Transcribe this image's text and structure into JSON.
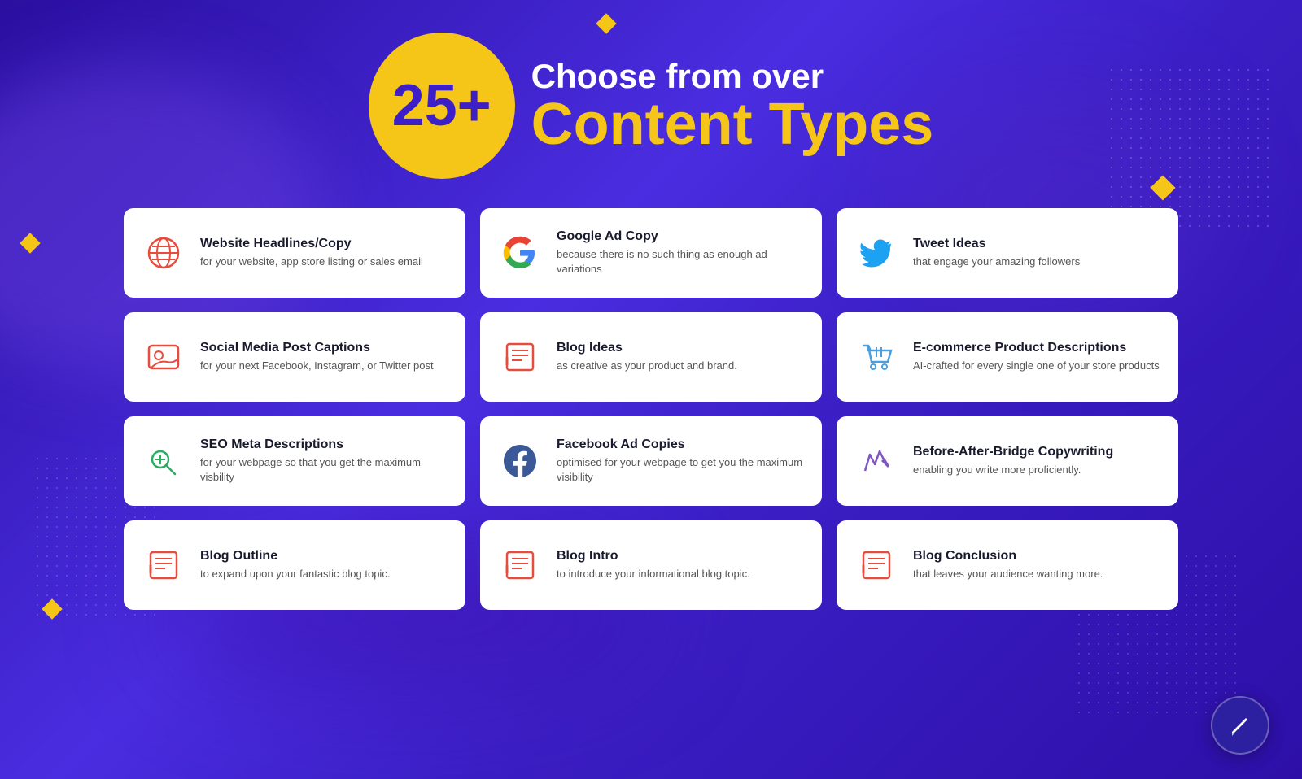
{
  "header": {
    "choose_text": "Choose from over",
    "number": "25+",
    "content_types": "Content Types"
  },
  "cards": [
    {
      "id": "website-headlines",
      "title": "Website Headlines/Copy",
      "desc": "for your website, app store listing or sales email",
      "icon_type": "globe"
    },
    {
      "id": "google-ad",
      "title": "Google Ad Copy",
      "desc": "because there is no such thing as enough ad variations",
      "icon_type": "google"
    },
    {
      "id": "tweet-ideas",
      "title": "Tweet Ideas",
      "desc": "that engage your amazing followers",
      "icon_type": "twitter"
    },
    {
      "id": "social-media",
      "title": "Social Media Post Captions",
      "desc": "for your next Facebook, Instagram, or Twitter post",
      "icon_type": "social"
    },
    {
      "id": "blog-ideas",
      "title": "Blog Ideas",
      "desc": "as creative as your product and brand.",
      "icon_type": "blog"
    },
    {
      "id": "ecommerce",
      "title": "E-commerce Product Descriptions",
      "desc": "AI-crafted for every single one of your store products",
      "icon_type": "ecomm"
    },
    {
      "id": "seo-meta",
      "title": "SEO Meta Descriptions",
      "desc": "for your webpage so that you get the maximum visbility",
      "icon_type": "seo"
    },
    {
      "id": "facebook-ad",
      "title": "Facebook Ad Copies",
      "desc": "optimised for your webpage to get you the maximum visibility",
      "icon_type": "facebook"
    },
    {
      "id": "before-after",
      "title": "Before-After-Bridge Copywriting",
      "desc": "enabling you write more proficiently.",
      "icon_type": "bridge"
    },
    {
      "id": "blog-outline",
      "title": "Blog Outline",
      "desc": "to expand upon your fantastic blog topic.",
      "icon_type": "outline"
    },
    {
      "id": "blog-intro",
      "title": "Blog Intro",
      "desc": "to introduce your informational blog topic.",
      "icon_type": "intro"
    },
    {
      "id": "blog-conclusion",
      "title": "Blog Conclusion",
      "desc": "that leaves your audience wanting more.",
      "icon_type": "conclusion"
    }
  ],
  "bottom_button": {
    "label": "pen-icon"
  }
}
